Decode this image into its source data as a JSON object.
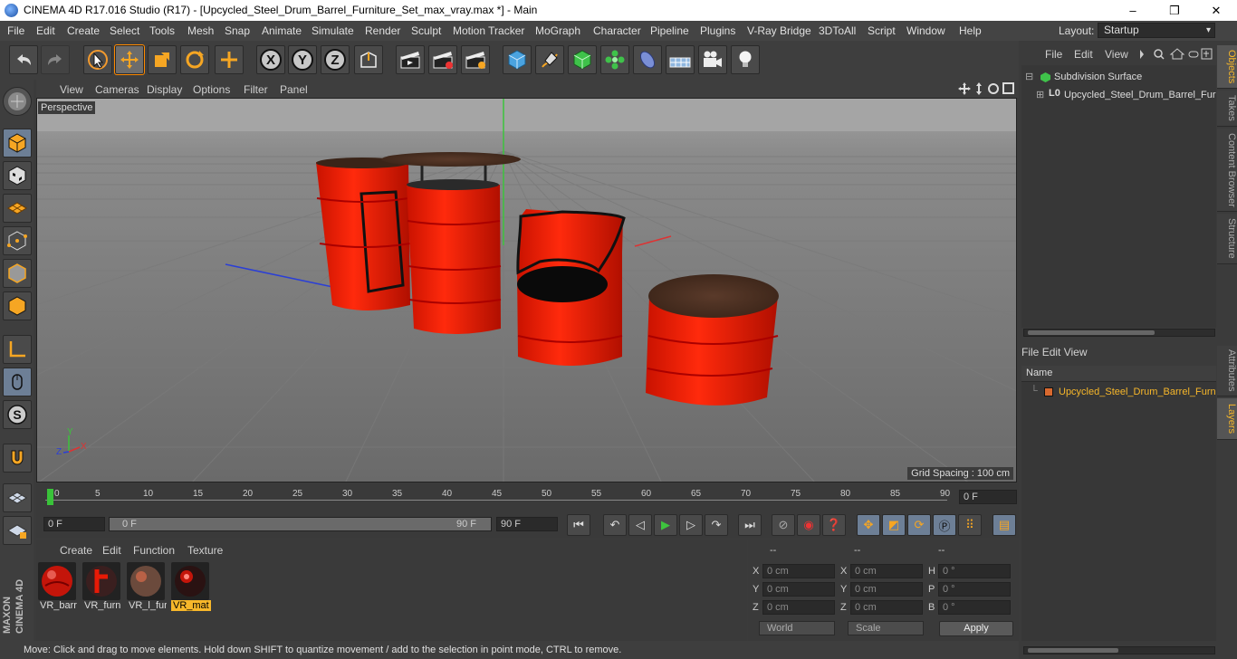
{
  "window": {
    "title": "CINEMA 4D R17.016 Studio (R17) - [Upcycled_Steel_Drum_Barrel_Furniture_Set_max_vray.max *] - Main",
    "minimize": "–",
    "maximize": "❐",
    "close": "✕"
  },
  "menu": [
    "File",
    "Edit",
    "Create",
    "Select",
    "Tools",
    "Mesh",
    "Snap",
    "Animate",
    "Simulate",
    "Render",
    "Sculpt",
    "Motion Tracker",
    "MoGraph",
    "Character",
    "Pipeline",
    "Plugins",
    "V-Ray Bridge",
    "3DToAll",
    "Script",
    "Window",
    "Help"
  ],
  "layout": {
    "label": "Layout:",
    "value": "Startup"
  },
  "viewport": {
    "menu": [
      "View",
      "Cameras",
      "Display",
      "Options",
      "Filter",
      "Panel"
    ],
    "label": "Perspective",
    "grid_spacing": "Grid Spacing : 100 cm",
    "axis_labels": {
      "y": "Y",
      "x": "X",
      "z": "Z"
    }
  },
  "timeline": {
    "ticks": [
      "0",
      "5",
      "10",
      "15",
      "20",
      "25",
      "30",
      "35",
      "40",
      "45",
      "50",
      "55",
      "60",
      "65",
      "70",
      "75",
      "80",
      "85",
      "90"
    ],
    "current_frame": "0 F"
  },
  "transport": {
    "start_field": "0 F",
    "slider_start": "0 F",
    "slider_end": "90 F",
    "end_field": "90 F"
  },
  "material_manager": {
    "menu": [
      "Create",
      "Edit",
      "Function",
      "Texture"
    ],
    "materials": [
      {
        "name": "VR_barr",
        "selected": false
      },
      {
        "name": "VR_furn",
        "selected": false
      },
      {
        "name": "VR_l_fur",
        "selected": false
      },
      {
        "name": "VR_mat",
        "selected": true
      }
    ]
  },
  "coordinates": {
    "headers": [
      "--",
      "--",
      "--"
    ],
    "rows": [
      {
        "l1": "X",
        "v1": "0 cm",
        "l2": "X",
        "v2": "0 cm",
        "l3": "H",
        "v3": "0 °"
      },
      {
        "l1": "Y",
        "v1": "0 cm",
        "l2": "Y",
        "v2": "0 cm",
        "l3": "P",
        "v3": "0 °"
      },
      {
        "l1": "Z",
        "v1": "0 cm",
        "l2": "Z",
        "v2": "0 cm",
        "l3": "B",
        "v3": "0 °"
      }
    ],
    "mode_dropdown": "World",
    "type_dropdown": "Scale",
    "apply": "Apply"
  },
  "status": "Move: Click and drag to move elements. Hold down SHIFT to quantize movement / add to the selection in point mode, CTRL to remove.",
  "objects_panel": {
    "menu": [
      "File",
      "Edit",
      "View"
    ],
    "items": [
      {
        "name": "Subdivision Surface"
      },
      {
        "name": "Upcycled_Steel_Drum_Barrel_Furniture_Set"
      }
    ]
  },
  "layers_panel": {
    "menu": [
      "File",
      "Edit",
      "View"
    ],
    "column": "Name",
    "items": [
      {
        "name": "Upcycled_Steel_Drum_Barrel_Furniture_Set"
      }
    ]
  },
  "side_tabs": [
    "Objects",
    "Takes",
    "Content Browser",
    "Structure",
    "Attributes",
    "Layers"
  ],
  "colors": {
    "accent": "#f7b72a",
    "barrel_red": "#e81a06",
    "selection": "#ff8a00"
  }
}
